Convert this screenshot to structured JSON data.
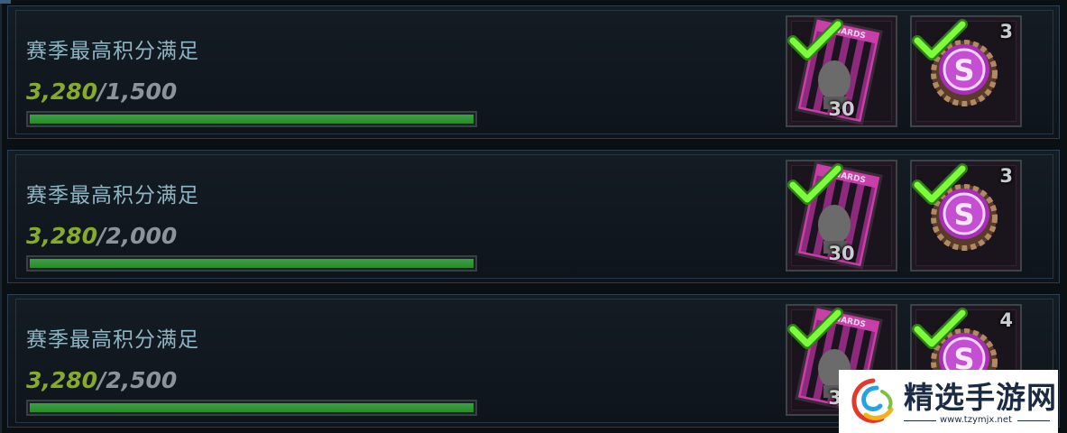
{
  "rows": [
    {
      "title": "赛季最高积分满足",
      "current": "3,280",
      "separator": "/",
      "goal": "1,500",
      "progress_fraction": 1.0,
      "card_reward": {
        "icon": "awards-card-icon",
        "quantity": "30",
        "claimed": true
      },
      "cap_reward": {
        "icon": "bottle-cap-icon",
        "quantity": "3",
        "claimed": true
      }
    },
    {
      "title": "赛季最高积分满足",
      "current": "3,280",
      "separator": "/",
      "goal": "2,000",
      "progress_fraction": 1.0,
      "card_reward": {
        "icon": "awards-card-icon",
        "quantity": "30",
        "claimed": true
      },
      "cap_reward": {
        "icon": "bottle-cap-icon",
        "quantity": "3",
        "claimed": true
      }
    },
    {
      "title": "赛季最高积分满足",
      "current": "3,280",
      "separator": "/",
      "goal": "2,500",
      "progress_fraction": 1.0,
      "card_reward": {
        "icon": "awards-card-icon",
        "quantity": "30",
        "claimed": true
      },
      "cap_reward": {
        "icon": "bottle-cap-icon",
        "quantity": "4",
        "claimed": true
      }
    }
  ],
  "card_label": "AWARDS",
  "cap_letter": "S",
  "watermark": {
    "text": "精选手游网",
    "url": "www.tzymjx.net"
  },
  "colors": {
    "current_value": "#86ab2b",
    "goal_value": "#8c949a",
    "title": "#8fb4c3",
    "bar_fill": "#2e9a35",
    "check": "#7dfc3a",
    "card_magenta": "#c83fa9",
    "cap_purple": "#a52fb8"
  }
}
